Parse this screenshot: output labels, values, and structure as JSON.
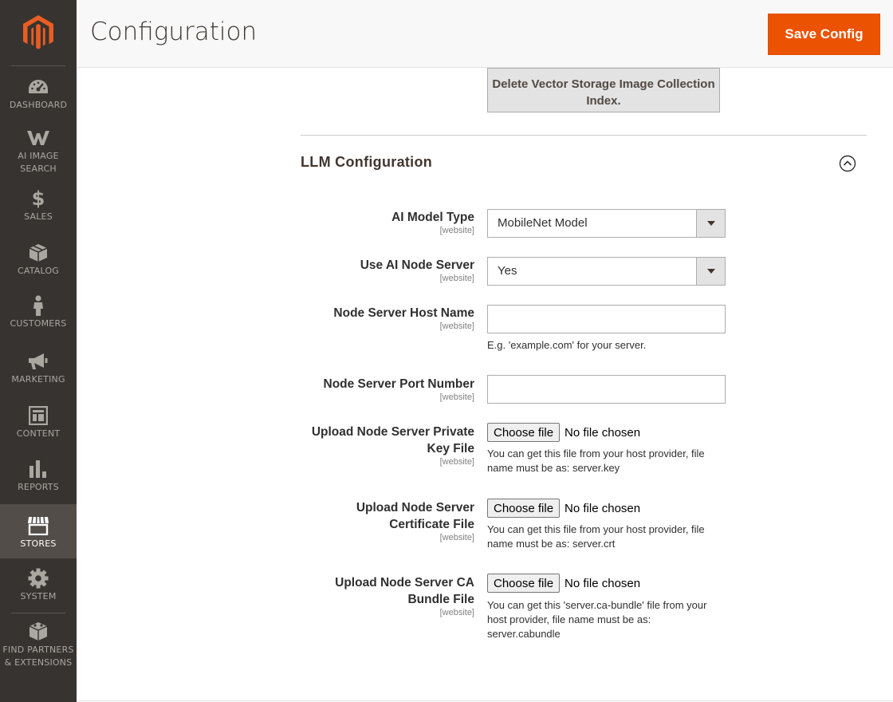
{
  "sidebar": {
    "items": [
      {
        "id": "dashboard",
        "label": "DASHBOARD",
        "icon": "dashboard-icon"
      },
      {
        "id": "ai-image-search",
        "label": "AI IMAGE SEARCH",
        "icon": "w-logo-icon"
      },
      {
        "id": "sales",
        "label": "SALES",
        "icon": "dollar-icon"
      },
      {
        "id": "catalog",
        "label": "CATALOG",
        "icon": "box-icon"
      },
      {
        "id": "customers",
        "label": "CUSTOMERS",
        "icon": "person-icon"
      },
      {
        "id": "marketing",
        "label": "MARKETING",
        "icon": "megaphone-icon"
      },
      {
        "id": "content",
        "label": "CONTENT",
        "icon": "layout-icon"
      },
      {
        "id": "reports",
        "label": "REPORTS",
        "icon": "bar-chart-icon"
      },
      {
        "id": "stores",
        "label": "STORES",
        "icon": "storefront-icon",
        "active": true
      },
      {
        "id": "system",
        "label": "SYSTEM",
        "icon": "gear-icon"
      },
      {
        "id": "find-partners",
        "label": "FIND PARTNERS & EXTENSIONS",
        "icon": "blocks-icon"
      }
    ]
  },
  "header": {
    "title": "Configuration",
    "save_label": "Save Config"
  },
  "content": {
    "delete_button_label": "Delete Vector Storage Image Collection Index.",
    "section_title": "LLM Configuration",
    "fields": {
      "ai_model_type": {
        "label": "AI Model Type",
        "scope": "[website]",
        "value": "MobileNet Model"
      },
      "use_ai_node_server": {
        "label": "Use AI Node Server",
        "scope": "[website]",
        "value": "Yes"
      },
      "node_server_host": {
        "label": "Node Server Host Name",
        "scope": "[website]",
        "value": "",
        "note": "E.g. 'example.com' for your server."
      },
      "node_server_port": {
        "label": "Node Server Port Number",
        "scope": "[website]",
        "value": ""
      },
      "private_key_file": {
        "label": "Upload Node Server Private Key File",
        "scope": "[website]",
        "button": "Choose file",
        "status": "No file chosen",
        "note": "You can get this file from your host provider, file name must be as: server.key"
      },
      "certificate_file": {
        "label": "Upload Node Server Certificate File",
        "scope": "[website]",
        "button": "Choose file",
        "status": "No file chosen",
        "note": "You can get this file from your host provider, file name must be as: server.crt"
      },
      "ca_bundle_file": {
        "label": "Upload Node Server CA Bundle File",
        "scope": "[website]",
        "button": "Choose file",
        "status": "No file chosen",
        "note": "You can get this 'server.ca-bundle' file from your host provider, file name must be as: server.cabundle"
      }
    }
  },
  "colors": {
    "sidebar_bg": "#373330",
    "sidebar_active": "#524d49",
    "accent": "#eb5202",
    "logo": "#e85d22"
  }
}
